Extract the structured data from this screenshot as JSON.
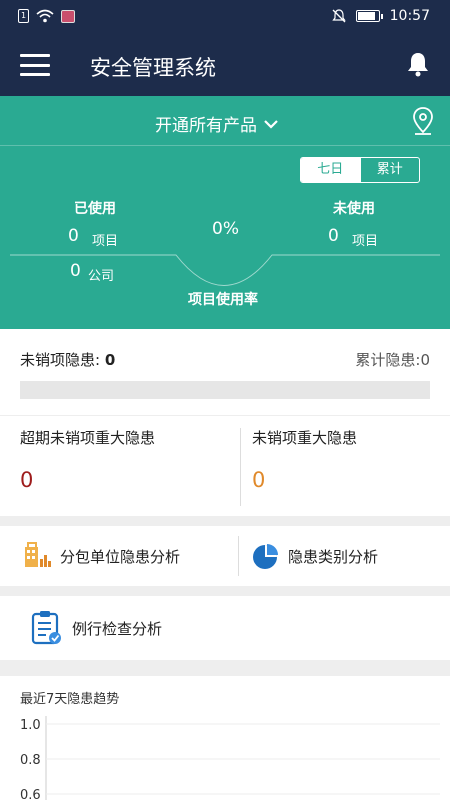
{
  "status_bar": {
    "sim_label": "1",
    "time": "10:57",
    "battery_level": 0.85
  },
  "app_bar": {
    "title": "安全管理系统"
  },
  "hero": {
    "product_select": "开通所有产品",
    "period_tabs": [
      "七日",
      "累计"
    ],
    "active_period": "七日",
    "used": {
      "label": "已使用",
      "projects": "0",
      "projects_unit": "项目",
      "companies": "0",
      "companies_unit": "公司"
    },
    "unused": {
      "label": "未使用",
      "projects": "0",
      "projects_unit": "项目"
    },
    "usage_rate": {
      "value": "0%",
      "label": "项目使用率"
    }
  },
  "hazards": {
    "open_label": "未销项隐患: ",
    "open_value": "0",
    "total_label": "累计隐患:",
    "total_value": "0",
    "progress": 0
  },
  "major_hazards": {
    "overdue": {
      "title": "超期未销项重大隐患",
      "value": "0",
      "color": "#9e1c1c"
    },
    "open": {
      "title": "未销项重大隐患",
      "value": "0",
      "color": "#e0892a"
    }
  },
  "analysis": {
    "subcontractor": "分包单位隐患分析",
    "category": "隐患类别分析",
    "routine": "例行检查分析"
  },
  "trend": {
    "title": "最近7天隐患趋势",
    "chart_data": {
      "type": "line",
      "title": "",
      "xlabel": "",
      "ylabel": "",
      "y_ticks": [
        "1.0",
        "0.8",
        "0.6"
      ],
      "ylim": [
        0.6,
        1.0
      ],
      "series": []
    }
  },
  "colors": {
    "header": "#1d2c4b",
    "accent": "#2aaa92",
    "overdue": "#9e1c1c",
    "warning": "#e0892a"
  }
}
